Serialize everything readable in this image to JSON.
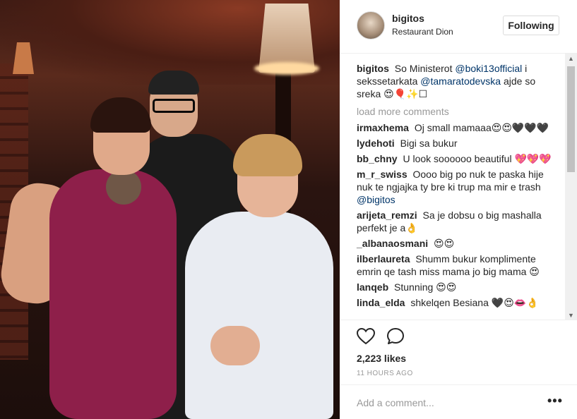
{
  "post": {
    "username": "bigitos",
    "location": "Restaurant Dion",
    "follow_label": "Following"
  },
  "caption": {
    "user": "bigitos",
    "text_1": "So Ministerot",
    "mention_1": "@boki13official",
    "text_2": "i sekssetarkata",
    "mention_2": "@tamaratodevska",
    "text_3": "ajde so sreka 😍🎈✨☐"
  },
  "load_more": "load more comments",
  "comments": [
    {
      "user": "irmaxhema",
      "text": "Oj small mamaaa😍😍🖤🖤🖤"
    },
    {
      "user": "lydehoti",
      "text": "Bigi sa bukur"
    },
    {
      "user": "bb_chny",
      "text": "U look soooooo beautiful 💖💖💖"
    },
    {
      "user": "m_r_swiss",
      "text": "Oooo big po nuk te paska hije nuk te ngjajka ty bre ki trup ma mir e trash",
      "mention": "@bigitos"
    },
    {
      "user": "arijeta_remzi",
      "text": "Sa je dobsu o big mashalla perfekt je a👌"
    },
    {
      "user": "_albanaosmani",
      "text": "😍😍"
    },
    {
      "user": "ilberlaureta",
      "text": "Shumm bukur komplimente emrin qe tash miss mama jo big mama 😍"
    },
    {
      "user": "lanqeb",
      "text": "Stunning 😍😍"
    },
    {
      "user": "linda_elda",
      "text": "shkelqen Besiana 🖤😍👄👌"
    }
  ],
  "likes": "2,223 likes",
  "time": "11 HOURS AGO",
  "add_comment_placeholder": "Add a comment...",
  "more_label": "•••"
}
